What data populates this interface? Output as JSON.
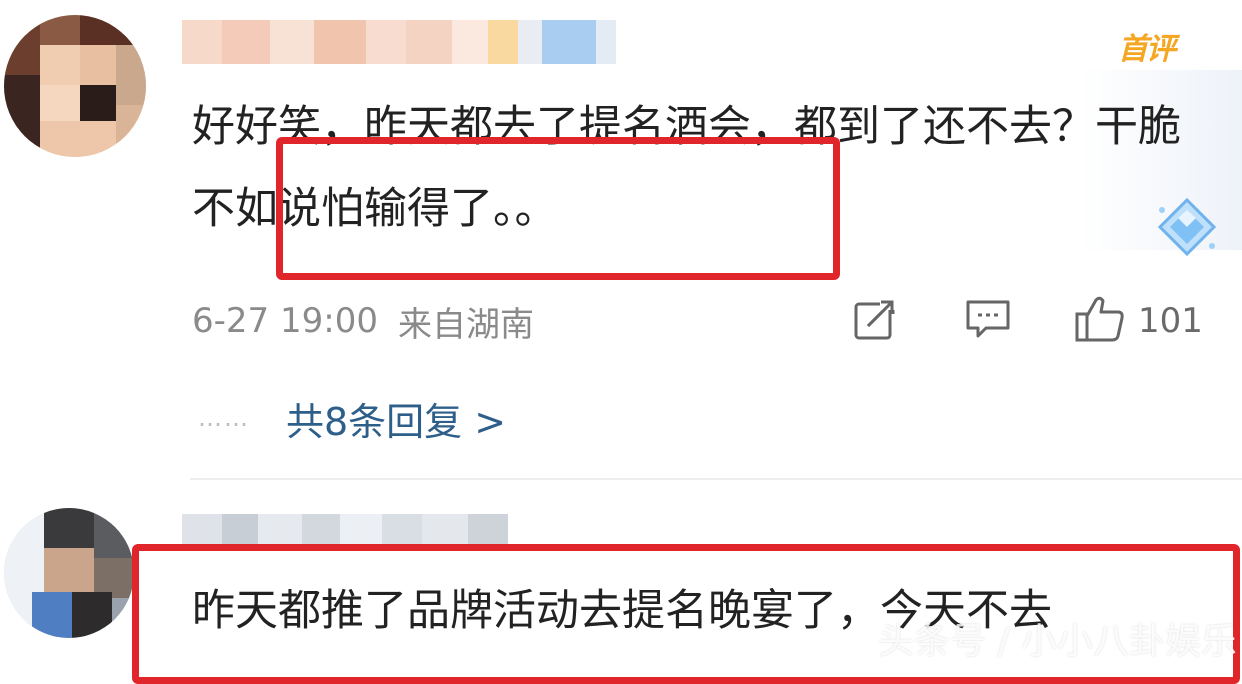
{
  "comments": [
    {
      "badge": "首评",
      "text": "好好笑，昨天都去了提名酒会，都到了还不去？干脆不如说怕输得了。。",
      "time": "6-27 19:00",
      "location": "来自湖南",
      "likes": "101",
      "reply_dots": "……",
      "replies_link": "共8条回复 >"
    },
    {
      "text": "昨天都推了品牌活动去提名晚宴了，今天不去"
    }
  ],
  "icons": {
    "share": "share-icon",
    "comment": "comment-icon",
    "like": "thumbs-up-icon",
    "badge": "diamond-badge-icon"
  },
  "colors": {
    "highlight": "#e0262b",
    "top_badge": "#f5a623",
    "link": "#2e5f8a",
    "meta": "#8a8a8a"
  },
  "watermark": "头条号 / 小小八卦娱乐"
}
